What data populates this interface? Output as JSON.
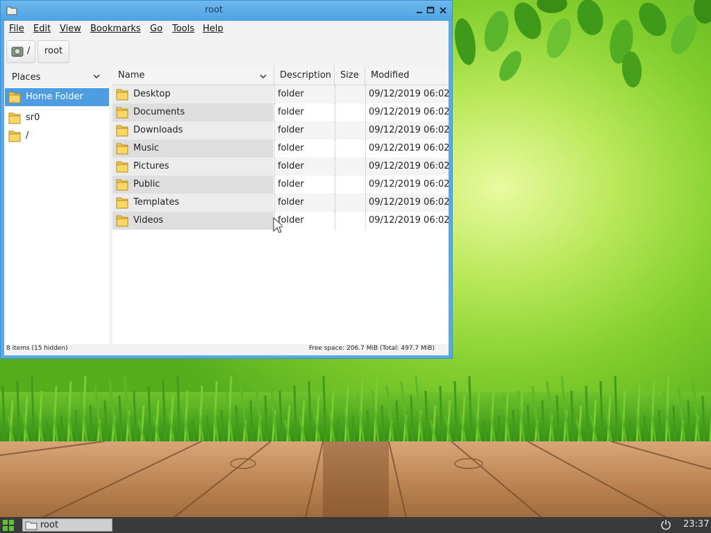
{
  "window": {
    "title": "root",
    "controls": [
      "minimize",
      "maximize",
      "close"
    ]
  },
  "menu": {
    "items": [
      {
        "label": "File"
      },
      {
        "label": "Edit"
      },
      {
        "label": "View"
      },
      {
        "label": "Bookmarks"
      },
      {
        "label": "Go"
      },
      {
        "label": "Tools"
      },
      {
        "label": "Help"
      }
    ]
  },
  "location": {
    "root_label": "/",
    "current": "root"
  },
  "places": {
    "header": "Places",
    "items": [
      {
        "label": "Home Folder",
        "selected": true
      },
      {
        "label": "sr0",
        "selected": false
      },
      {
        "label": "/",
        "selected": false
      }
    ]
  },
  "columns": {
    "name": "Name",
    "description": "Description",
    "size": "Size",
    "modified": "Modified"
  },
  "files": [
    {
      "name": "Desktop",
      "description": "folder",
      "size": "",
      "modified": "09/12/2019 06:02"
    },
    {
      "name": "Documents",
      "description": "folder",
      "size": "",
      "modified": "09/12/2019 06:02"
    },
    {
      "name": "Downloads",
      "description": "folder",
      "size": "",
      "modified": "09/12/2019 06:02"
    },
    {
      "name": "Music",
      "description": "folder",
      "size": "",
      "modified": "09/12/2019 06:02"
    },
    {
      "name": "Pictures",
      "description": "folder",
      "size": "",
      "modified": "09/12/2019 06:02"
    },
    {
      "name": "Public",
      "description": "folder",
      "size": "",
      "modified": "09/12/2019 06:02"
    },
    {
      "name": "Templates",
      "description": "folder",
      "size": "",
      "modified": "09/12/2019 06:02"
    },
    {
      "name": "Videos",
      "description": "folder",
      "size": "",
      "modified": "09/12/2019 06:02"
    }
  ],
  "status": {
    "left": "8 items (15 hidden)",
    "right": "Free space: 206.7 MiB (Total: 497.7 MiB)"
  },
  "taskbar": {
    "task_label": "root",
    "clock": "23:37"
  },
  "colors": {
    "titlebar": "#5aa9e6",
    "selection": "#4e9de0",
    "folder": "#f2c84b",
    "taskbar": "#3a3a3a"
  },
  "icons": {
    "folder": "folder-icon",
    "drive": "drive-icon",
    "start": "start-menu-icon",
    "power": "power-icon"
  }
}
